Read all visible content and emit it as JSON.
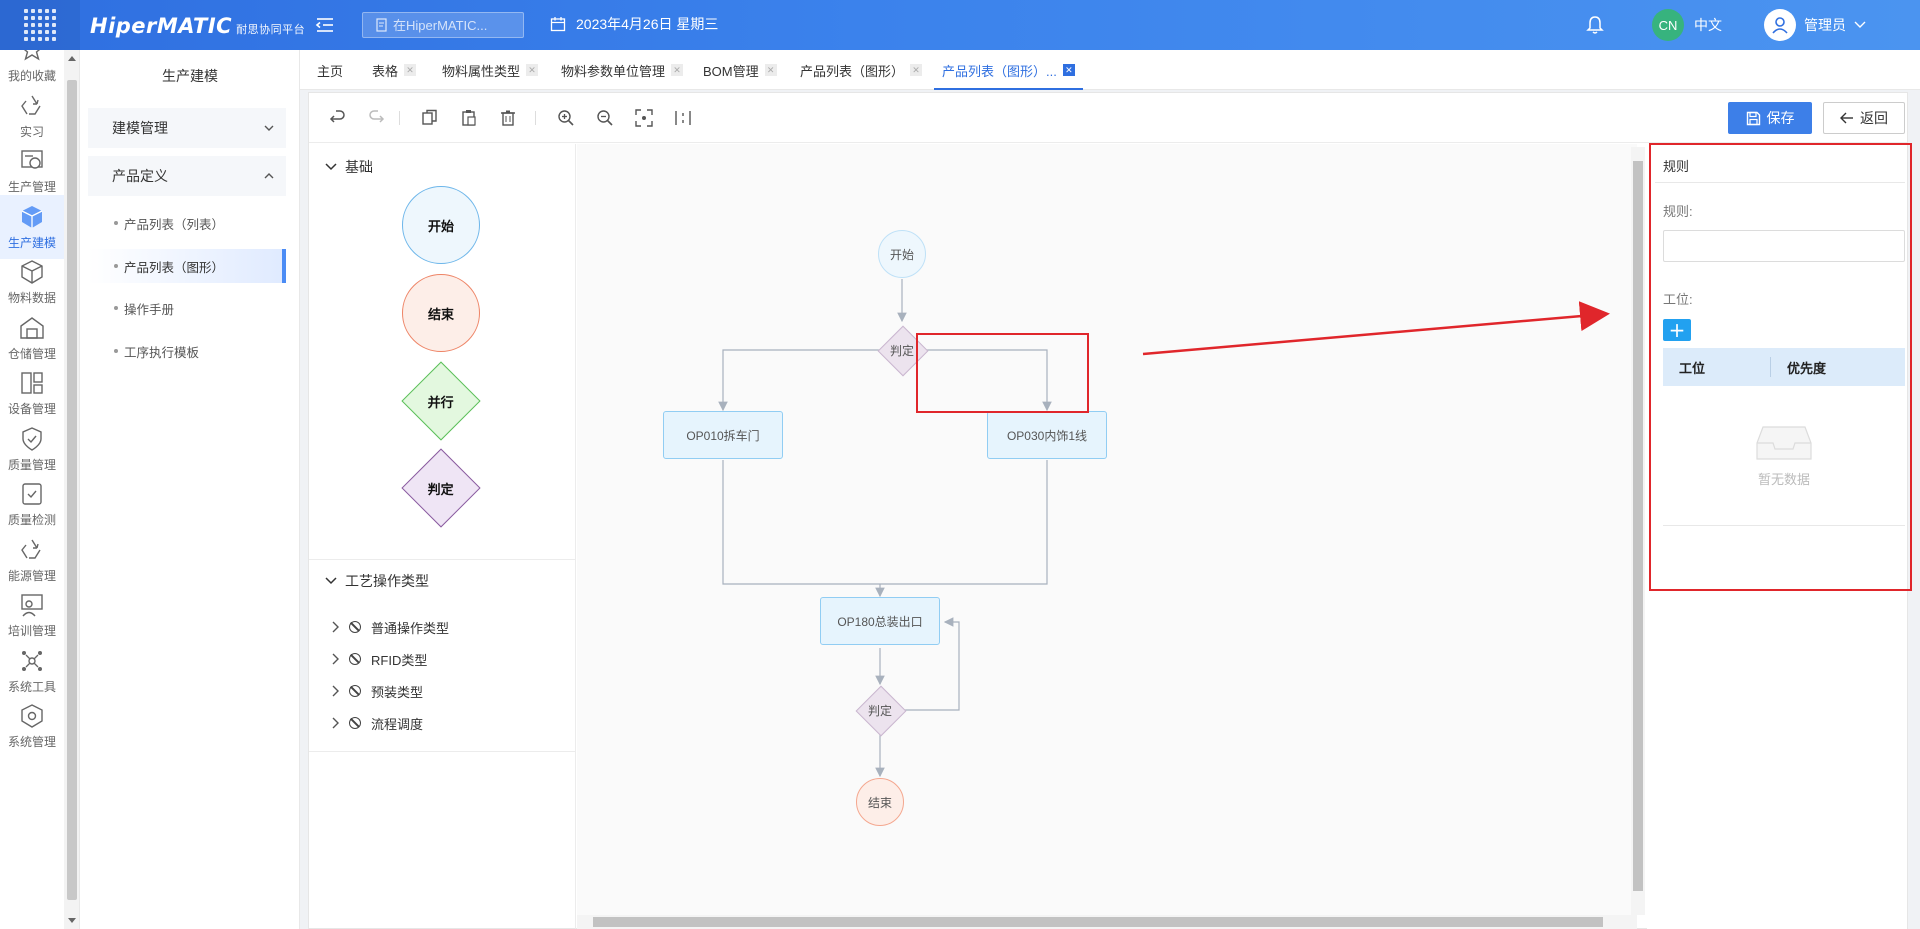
{
  "header": {
    "logo": "HiperMATIC",
    "logo_sub": "耐思协同平台",
    "search_placeholder": "在HiperMATIC...",
    "date": "2023年4月26日 星期三",
    "lang_badge": "CN",
    "lang_label": "中文",
    "user_name": "管理员"
  },
  "rail": {
    "items": [
      {
        "label": "我的收藏",
        "icon": "star-icon"
      },
      {
        "label": "实习",
        "icon": "recycle-icon"
      },
      {
        "label": "生产管理",
        "icon": "production-icon"
      },
      {
        "label": "生产建模",
        "icon": "cube-icon",
        "active": true
      },
      {
        "label": "物料数据",
        "icon": "material-icon"
      },
      {
        "label": "仓储管理",
        "icon": "warehouse-icon"
      },
      {
        "label": "设备管理",
        "icon": "device-icon"
      },
      {
        "label": "质量管理",
        "icon": "shield-icon"
      },
      {
        "label": "质量检测",
        "icon": "shield-check-icon"
      },
      {
        "label": "能源管理",
        "icon": "recycle-icon"
      },
      {
        "label": "培训管理",
        "icon": "training-icon"
      },
      {
        "label": "系统工具",
        "icon": "network-icon"
      },
      {
        "label": "系统管理",
        "icon": "settings-cube-icon"
      }
    ]
  },
  "subnav": {
    "title": "生产建模",
    "groups": [
      {
        "label": "建模管理",
        "expanded": false
      },
      {
        "label": "产品定义",
        "expanded": true
      }
    ],
    "items": [
      {
        "label": "产品列表（列表）"
      },
      {
        "label": "产品列表（图形）",
        "active": true
      },
      {
        "label": "操作手册"
      },
      {
        "label": "工序执行模板"
      }
    ]
  },
  "tabs": [
    {
      "label": "主页",
      "closable": false
    },
    {
      "label": "表格",
      "closable": true
    },
    {
      "label": "物料属性类型",
      "closable": true
    },
    {
      "label": "物料参数单位管理",
      "closable": true
    },
    {
      "label": "BOM管理",
      "closable": true
    },
    {
      "label": "产品列表（图形）",
      "closable": true
    },
    {
      "label": "产品列表（图形）...",
      "closable": true,
      "active": true
    }
  ],
  "toolbar": {
    "icons": [
      "undo-icon",
      "redo-icon",
      "copy-icon",
      "paste-icon",
      "delete-icon",
      "zoom-in-icon",
      "zoom-out-icon",
      "fit-icon",
      "align-icon"
    ],
    "save_label": "保存",
    "back_label": "返回"
  },
  "palette": {
    "basic_title": "基础",
    "shapes": [
      {
        "label": "开始",
        "kind": "circle",
        "fill": "#eef7fd",
        "stroke": "#6db6ea"
      },
      {
        "label": "结束",
        "kind": "circle",
        "fill": "#fdeee8",
        "stroke": "#ee8466"
      },
      {
        "label": "并行",
        "kind": "diamond",
        "fill": "#e3f8df",
        "stroke": "#5bc05a"
      },
      {
        "label": "判定",
        "kind": "diamond",
        "fill": "#efe5f5",
        "stroke": "#8a5ba0"
      }
    ],
    "op_title": "工艺操作类型",
    "op_types": [
      {
        "label": "普通操作类型"
      },
      {
        "label": "RFID类型"
      },
      {
        "label": "预装类型"
      },
      {
        "label": "流程调度"
      }
    ]
  },
  "flow": {
    "start": "开始",
    "judge": "判定",
    "op1": "OP010拆车门",
    "op2": "OP030内饰1线",
    "op3": "OP180总装出口",
    "end": "结束"
  },
  "rule_panel": {
    "title": "规则",
    "rule_label": "规则:",
    "rule_value": "",
    "station_label": "工位:",
    "col_station": "工位",
    "col_priority": "优先度",
    "empty_text": "暂无数据"
  },
  "colors": {
    "header_start": "#2f6fe0",
    "accent": "#3d7fe8",
    "annotation": "#e0262b"
  }
}
